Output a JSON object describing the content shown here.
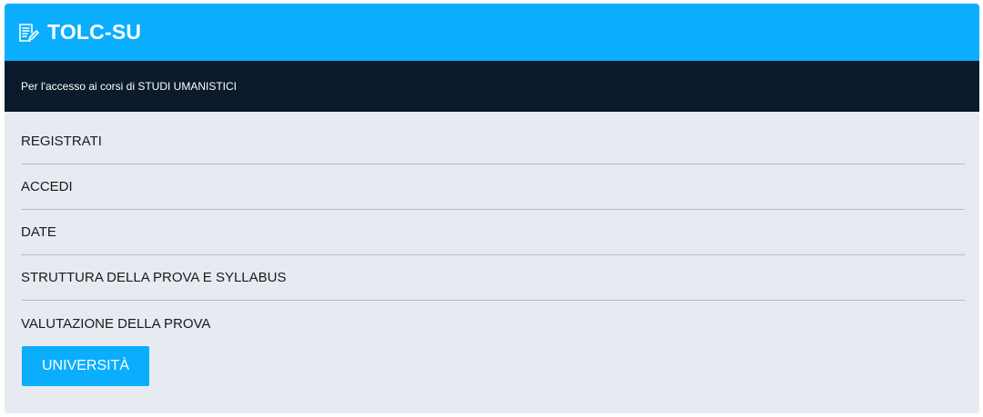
{
  "header": {
    "icon": "document-pen-icon",
    "title": "TOLC-SU",
    "background": "#0aaefc"
  },
  "subheader": {
    "text": "Per l'accesso ai corsi di STUDI UMANISTICI",
    "background": "#0b1b2b"
  },
  "menu": {
    "items": [
      {
        "label": "REGISTRATI"
      },
      {
        "label": "ACCEDI"
      },
      {
        "label": "DATE"
      },
      {
        "label": "STRUTTURA DELLA PROVA E SYLLABUS"
      },
      {
        "label": "VALUTAZIONE DELLA PROVA"
      }
    ]
  },
  "universita_button": {
    "label": "UNIVERSITÀ",
    "color": "#0aaefc"
  }
}
